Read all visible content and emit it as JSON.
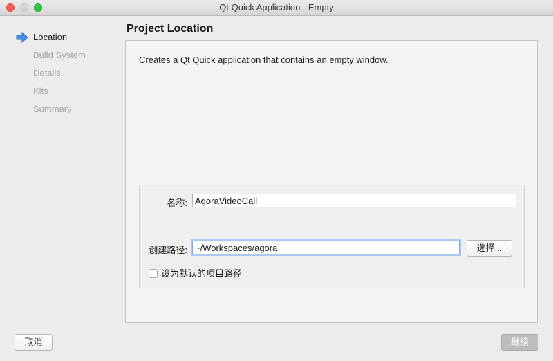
{
  "window": {
    "title": "Qt Quick Application - Empty"
  },
  "sidebar": {
    "steps": [
      {
        "label": "Location",
        "active": true
      },
      {
        "label": "Build System",
        "active": false
      },
      {
        "label": "Details",
        "active": false
      },
      {
        "label": "Kits",
        "active": false
      },
      {
        "label": "Summary",
        "active": false
      }
    ],
    "active_indicator_icon": "arrow-right-icon"
  },
  "page": {
    "title": "Project Location",
    "description": "Creates a Qt Quick application that contains an empty window."
  },
  "form": {
    "name_label": "名称:",
    "name_value": "AgoraVideoCall",
    "path_label": "创建路径:",
    "path_value": "~/Workspaces/agora",
    "browse_button": "选择...",
    "default_path_checkbox_label": "设为默认的项目路径",
    "default_path_checked": false
  },
  "footer": {
    "cancel_button": "取消",
    "continue_button": "继续",
    "continue_enabled": false
  },
  "colors": {
    "close": "#fc5f57",
    "minimize": "#d5d5d5",
    "zoom": "#2bc840",
    "arrow_fill": "#4a8ee8",
    "focus_ring": "#a9c9f5"
  }
}
